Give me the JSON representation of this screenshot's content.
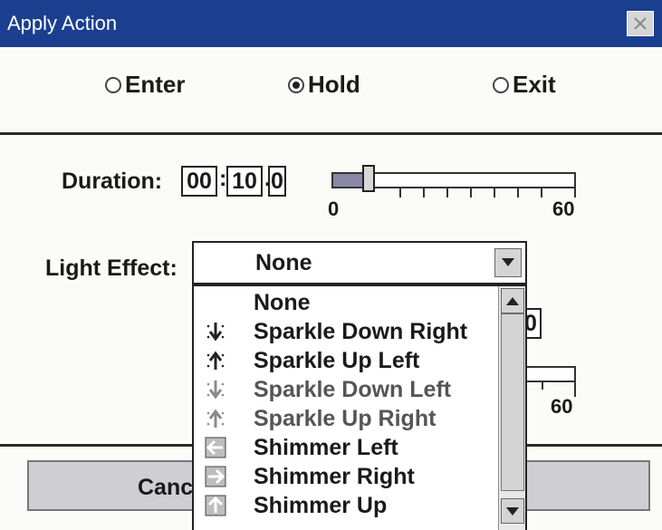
{
  "window": {
    "title": "Apply Action"
  },
  "actions": {
    "enter": "Enter",
    "hold": "Hold",
    "exit": "Exit",
    "selected": "Hold"
  },
  "duration": {
    "label": "Duration:",
    "minutes": "00",
    "seconds": "10",
    "tenths": "0",
    "slider": {
      "min": "0",
      "max": "60",
      "value_seconds": 10
    }
  },
  "light_effect": {
    "label": "Light Effect:",
    "selected": "None",
    "options": [
      {
        "label": "None",
        "icon": ""
      },
      {
        "label": "Sparkle Down Right",
        "icon": "sparkle-down-icon"
      },
      {
        "label": "Sparkle Up Left",
        "icon": "sparkle-up-icon"
      },
      {
        "label": "Sparkle Down Left",
        "icon": "sparkle-down-icon"
      },
      {
        "label": "Sparkle Up Right",
        "icon": "sparkle-up-icon"
      },
      {
        "label": "Shimmer Left",
        "icon": "shimmer-left-icon"
      },
      {
        "label": "Shimmer Right",
        "icon": "shimmer-right-icon"
      },
      {
        "label": "Shimmer Up",
        "icon": "shimmer-up-icon"
      }
    ]
  },
  "partially_visible": {
    "field_tail": "0",
    "slider_max": "60"
  },
  "buttons": {
    "cancel_partial": "Canc"
  },
  "colors": {
    "titlebar": "#1b3f8f",
    "slider_fill": "#8a88a8",
    "sparkle_dim": "#8a8a8a"
  }
}
